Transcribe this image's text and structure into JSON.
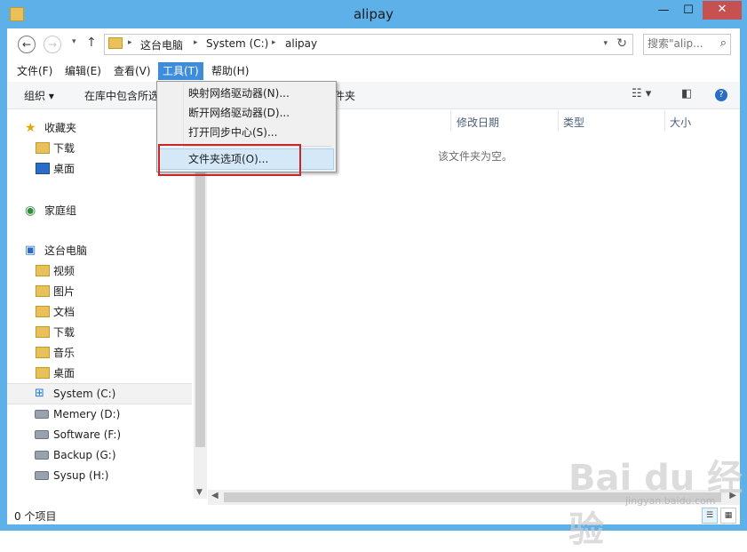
{
  "window": {
    "title": "alipay",
    "minimize": "—",
    "maximize": "☐",
    "close": "✕"
  },
  "address": {
    "back": "←",
    "forward": "→",
    "recent": "▾",
    "up": "↑",
    "crumbs": [
      "这台电脑",
      "System (C:)",
      "alipay"
    ],
    "separator": "▸",
    "dropdown": "▾",
    "refresh": "↻"
  },
  "search": {
    "placeholder": "搜索\"alip...",
    "icon": "⌕"
  },
  "menubar": {
    "items": [
      "文件(F)",
      "编辑(E)",
      "查看(V)",
      "工具(T)",
      "帮助(H)"
    ]
  },
  "toolbar": {
    "organize": "组织 ▾",
    "include_library": "在库中包含所选",
    "new_folder_tail": "件夹",
    "view_icon": "☷ ▾",
    "preview_icon": "◧",
    "help_icon": "?"
  },
  "columns": {
    "date": "修改日期",
    "type": "类型",
    "size": "大小"
  },
  "content": {
    "empty": "该文件夹为空。"
  },
  "nav": {
    "favorites": "收藏夹",
    "fav_items": [
      "下载",
      "桌面"
    ],
    "homegroup": "家庭组",
    "thispc": "这台电脑",
    "pc_items": [
      "视频",
      "图片",
      "文档",
      "下载",
      "音乐",
      "桌面"
    ],
    "drives": [
      "System (C:)",
      "Memery (D:)",
      "Software (F:)",
      "Backup (G:)",
      "Sysup (H:)"
    ]
  },
  "tools_menu": {
    "items": [
      "映射网络驱动器(N)...",
      "断开网络驱动器(D)...",
      "打开同步中心(S)...",
      "文件夹选项(O)..."
    ]
  },
  "status": {
    "count": "0 个项目"
  },
  "watermark": {
    "logo": "Bai du 经验",
    "url": "jingyan.baidu.com"
  }
}
